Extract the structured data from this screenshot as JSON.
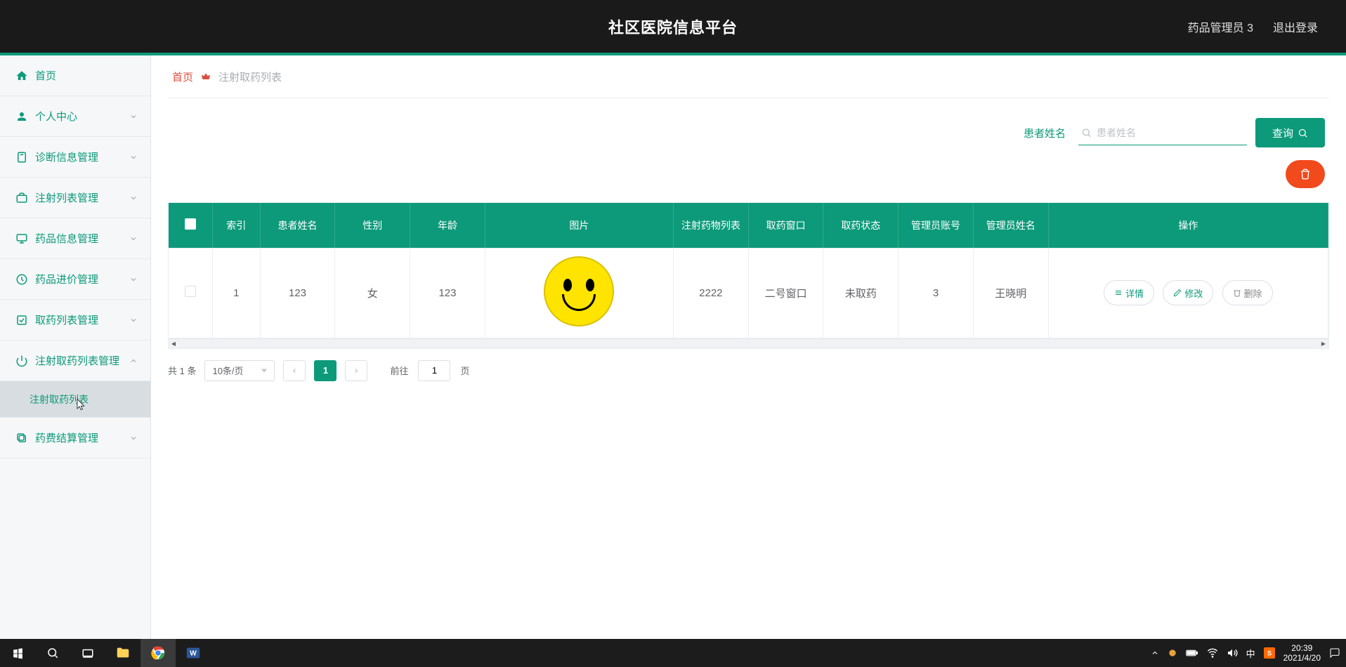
{
  "header": {
    "title": "社区医院信息平台",
    "user": "药品管理员 3",
    "logout": "退出登录"
  },
  "sidebar": {
    "items": [
      {
        "label": "首页"
      },
      {
        "label": "个人中心"
      },
      {
        "label": "诊断信息管理"
      },
      {
        "label": "注射列表管理"
      },
      {
        "label": "药品信息管理"
      },
      {
        "label": "药品进价管理"
      },
      {
        "label": "取药列表管理"
      },
      {
        "label": "注射取药列表管理"
      },
      {
        "label": "药费结算管理"
      }
    ],
    "submenu": {
      "label": "注射取药列表"
    }
  },
  "breadcrumb": {
    "home": "首页",
    "current": "注射取药列表"
  },
  "filter": {
    "label": "患者姓名",
    "placeholder": "患者姓名",
    "queryBtn": "查询"
  },
  "table": {
    "headers": [
      "索引",
      "患者姓名",
      "性别",
      "年龄",
      "图片",
      "注射药物列表",
      "取药窗口",
      "取药状态",
      "管理员账号",
      "管理员姓名",
      "操作"
    ],
    "row": {
      "index": "1",
      "patientName": "123",
      "gender": "女",
      "age": "123",
      "medsList": "2222",
      "window": "二号窗口",
      "status": "未取药",
      "adminId": "3",
      "adminName": "王晓明"
    },
    "ops": {
      "detail": "详情",
      "edit": "修改",
      "delete": "删除"
    }
  },
  "pagination": {
    "total": "共 1 条",
    "pageSize": "10条/页",
    "currentPage": "1",
    "gotoPrefix": "前往",
    "gotoInput": "1",
    "gotoSuffix": "页"
  },
  "taskbar": {
    "ime": "中",
    "time": "20:39",
    "date": "2021/4/20"
  }
}
